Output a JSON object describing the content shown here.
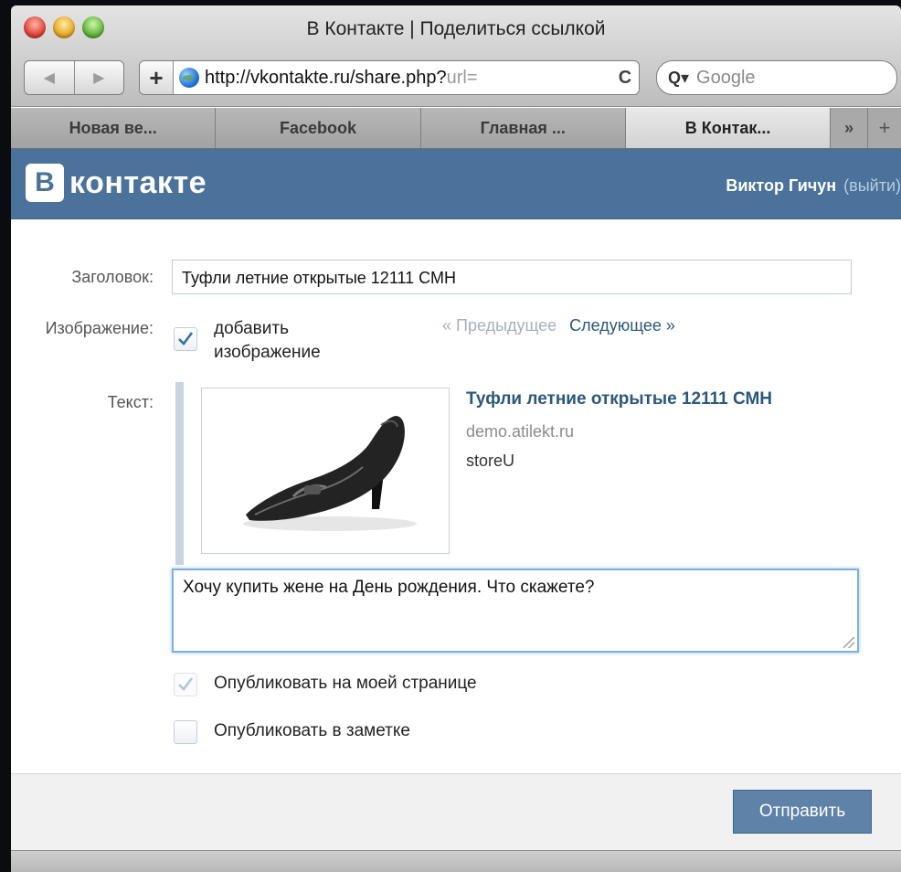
{
  "browser": {
    "window_title": "В Контакте | Поделиться ссылкой",
    "url_main": "http://vkontakte.ru/share.php?",
    "url_dim": "url=",
    "search_placeholder": "Google",
    "tabs": [
      {
        "label": "Новая ве..."
      },
      {
        "label": "Facebook"
      },
      {
        "label": "Главная ..."
      },
      {
        "label": "В Контак..."
      }
    ],
    "tabs_more": "»",
    "tab_add": "+",
    "back": "◀",
    "forward": "▶",
    "add_bookmark": "+",
    "reload": "C"
  },
  "vk": {
    "logo_letter": "В",
    "logo_text": "контакте",
    "user_name": "Виктор Гичун",
    "logout": "(выйти)"
  },
  "form": {
    "title_label": "Заголовок:",
    "title_value": "Туфли летние открытые 12111 СМН",
    "image_label": "Изображение:",
    "add_image_line1": "добавить",
    "add_image_line2": "изображение",
    "add_image_checked": true,
    "prev": "« Предыдущее",
    "next": "Следующее »",
    "text_label": "Текст:",
    "preview": {
      "title": "Туфли летние открытые 12111 СМН",
      "domain": "demo.atilekt.ru",
      "store": "storeU",
      "image_icon": "black-high-heel-shoe"
    },
    "message": "Хочу купить жене на День рождения. Что скажете?",
    "publish_page": "Опубликовать на моей странице",
    "publish_page_checked": true,
    "publish_note": "Опубликовать в заметке",
    "publish_note_checked": false,
    "submit": "Отправить"
  },
  "colors": {
    "vk_blue": "#4a729a",
    "link_blue": "#2b587a",
    "button_blue": "#5e82a8"
  }
}
